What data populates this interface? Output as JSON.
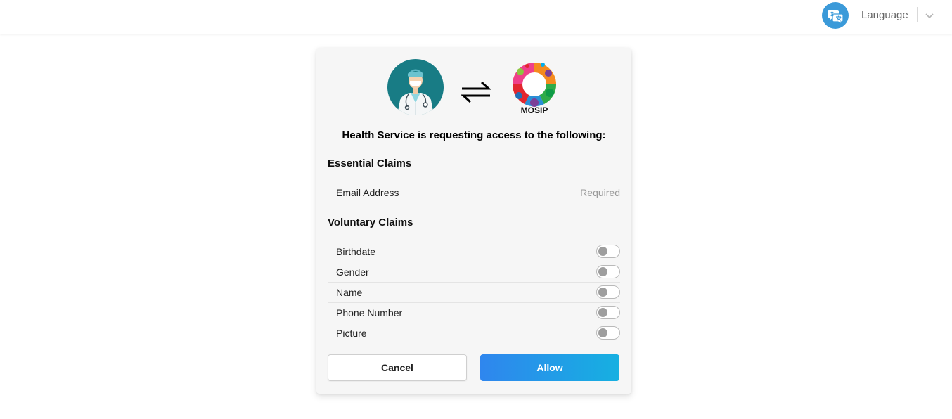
{
  "header": {
    "language_label": "Language",
    "language_icon": "language-chat-icon",
    "dropdown_icon": "chevron-down-icon"
  },
  "consent": {
    "client_logo": "doctor-avatar-logo",
    "exchange_icon": "swap-arrows-icon",
    "provider_logo_text": "MOSIP",
    "heading": "Health Service is requesting access to the following:",
    "essential": {
      "title": "Essential Claims",
      "items": [
        {
          "label": "Email Address",
          "status": "Required"
        }
      ]
    },
    "voluntary": {
      "title": "Voluntary Claims",
      "items": [
        {
          "label": "Birthdate",
          "enabled": false
        },
        {
          "label": "Gender",
          "enabled": false
        },
        {
          "label": "Name",
          "enabled": false
        },
        {
          "label": "Phone Number",
          "enabled": false
        },
        {
          "label": "Picture",
          "enabled": false
        }
      ]
    },
    "buttons": {
      "cancel": "Cancel",
      "allow": "Allow"
    }
  },
  "colors": {
    "accent_start": "#2f86ee",
    "accent_end": "#16b0e1",
    "language_icon_bg": "#3b9ad9",
    "doctor_bg": "#187c85"
  }
}
